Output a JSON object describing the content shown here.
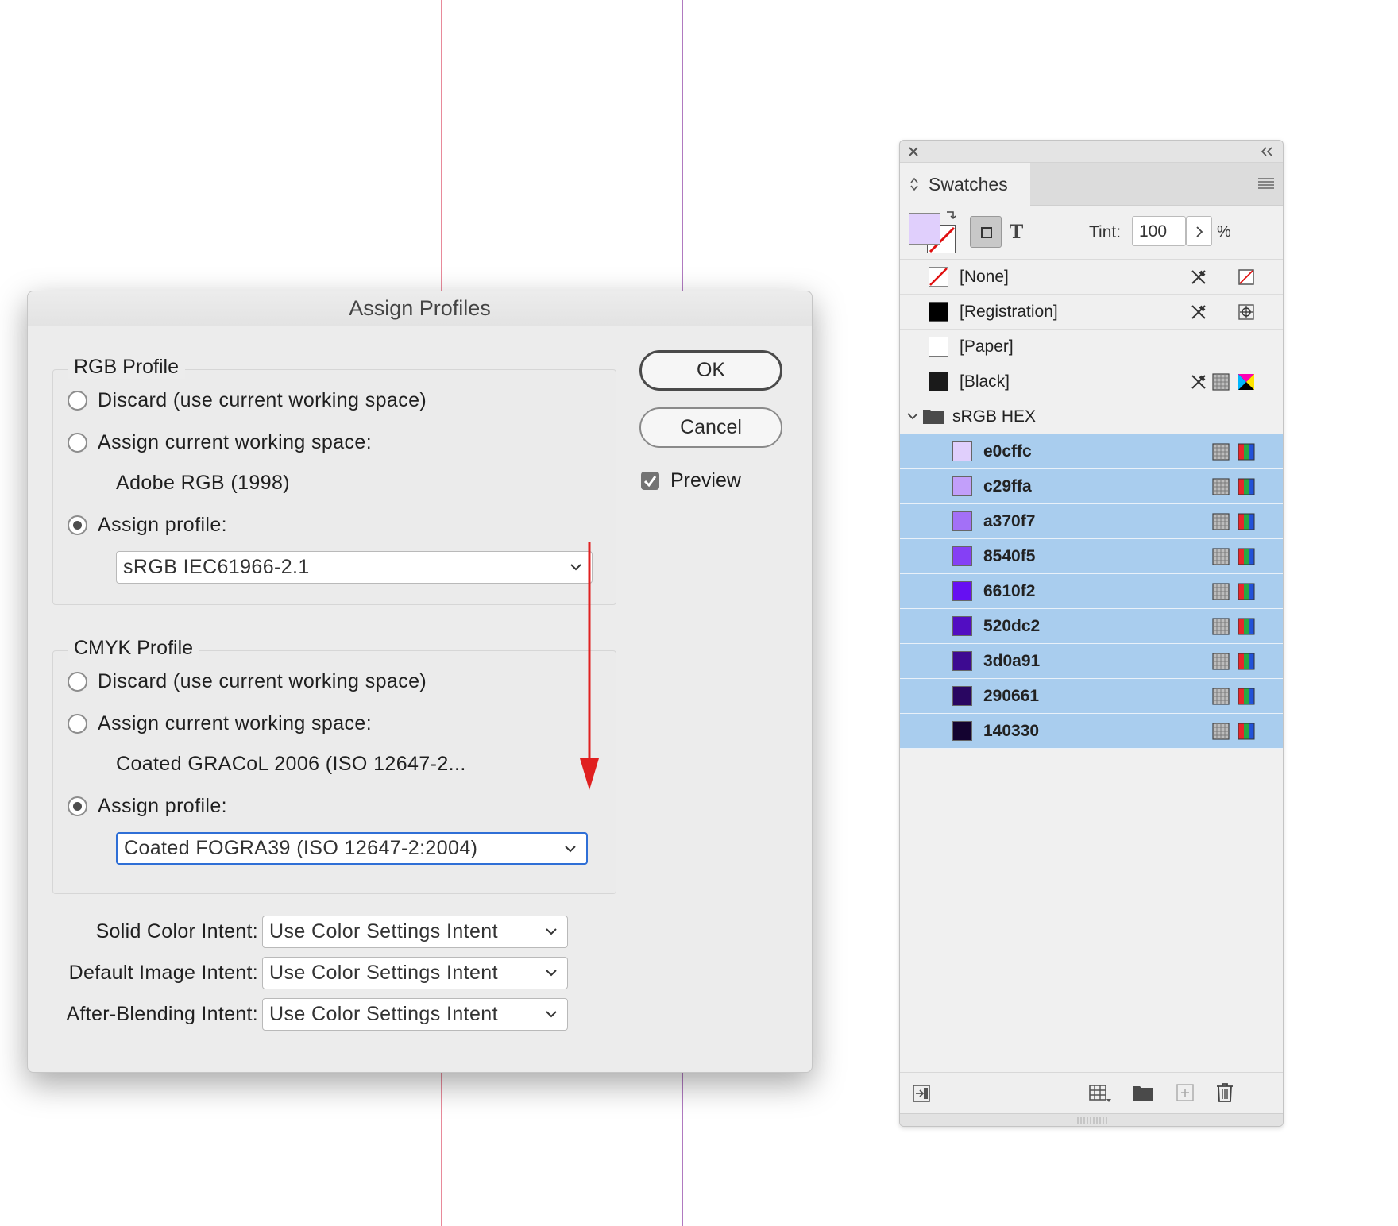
{
  "dialog": {
    "title": "Assign Profiles",
    "rgb": {
      "legend": "RGB Profile",
      "discard": "Discard (use current working space)",
      "assign_current": "Assign current working space:",
      "working_space": "Adobe RGB (1998)",
      "assign_profile": "Assign profile:",
      "selected_profile": "sRGB IEC61966-2.1",
      "selected_option": "assign_profile"
    },
    "cmyk": {
      "legend": "CMYK Profile",
      "discard": "Discard (use current working space)",
      "assign_current": "Assign current working space:",
      "working_space": "Coated GRACoL 2006 (ISO 12647-2...",
      "assign_profile": "Assign profile:",
      "selected_profile": "Coated FOGRA39 (ISO 12647-2:2004)",
      "selected_option": "assign_profile"
    },
    "ok": "OK",
    "cancel": "Cancel",
    "preview_label": "Preview",
    "preview_checked": true,
    "intents": [
      {
        "label": "Solid Color Intent:",
        "value": "Use Color Settings Intent"
      },
      {
        "label": "Default Image Intent:",
        "value": "Use Color Settings Intent"
      },
      {
        "label": "After-Blending Intent:",
        "value": "Use Color Settings Intent"
      }
    ]
  },
  "panel": {
    "title": "Swatches",
    "tint_label": "Tint:",
    "tint_value": "100",
    "percent": "%",
    "text_toggle": "T",
    "fill_color": "#e0cffc",
    "base_swatches": [
      {
        "name": "[None]",
        "color": "none"
      },
      {
        "name": "[Registration]",
        "color": "#000000"
      },
      {
        "name": "[Paper]",
        "color": "#ffffff"
      },
      {
        "name": "[Black]",
        "color": "#1a1a1a"
      }
    ],
    "group_name": "sRGB HEX",
    "group_swatches": [
      {
        "name": "e0cffc",
        "color": "#e0cffc"
      },
      {
        "name": "c29ffa",
        "color": "#c29ffa"
      },
      {
        "name": "a370f7",
        "color": "#a370f7"
      },
      {
        "name": "8540f5",
        "color": "#8540f5"
      },
      {
        "name": "6610f2",
        "color": "#6610f2"
      },
      {
        "name": "520dc2",
        "color": "#520dc2"
      },
      {
        "name": "3d0a91",
        "color": "#3d0a91"
      },
      {
        "name": "290661",
        "color": "#290661"
      },
      {
        "name": "140330",
        "color": "#140330"
      }
    ]
  },
  "colors": {
    "guide_red": "#e88a9a",
    "guide_black": "#444444",
    "guide_purple": "#b07ac0",
    "arrow_red": "#e02020",
    "selection_blue": "#a9cdee",
    "focus_blue": "#2f6fd6"
  }
}
